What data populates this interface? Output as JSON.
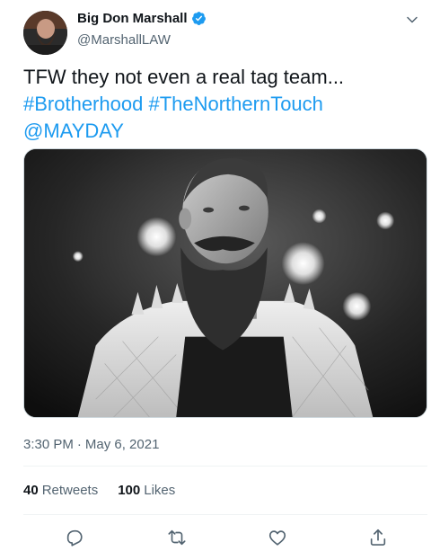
{
  "author": {
    "display_name": "Big Don Marshall",
    "handle": "@MarshallLAW",
    "verified": true,
    "verified_icon": "verified-badge-icon"
  },
  "menu": {
    "icon": "chevron-down-icon"
  },
  "tweet": {
    "text_line1": "TFW they not even a real tag team...",
    "hashtag1": "#Brotherhood",
    "hashtag2": "#TheNorthernTouch",
    "mention": "@MAYDAY"
  },
  "meta": {
    "time": "3:30 PM",
    "separator": "·",
    "date": "May 6, 2021"
  },
  "stats": {
    "retweets_count": "40",
    "retweets_label": "Retweets",
    "likes_count": "100",
    "likes_label": "Likes"
  },
  "actions": [
    {
      "name": "reply",
      "icon": "reply-icon"
    },
    {
      "name": "retweet",
      "icon": "retweet-icon"
    },
    {
      "name": "like",
      "icon": "heart-icon"
    },
    {
      "name": "share",
      "icon": "share-icon"
    }
  ],
  "colors": {
    "link": "#1d9bf0",
    "secondary_text": "#536471",
    "primary_text": "#0f1419",
    "divider": "#eff3f4"
  }
}
